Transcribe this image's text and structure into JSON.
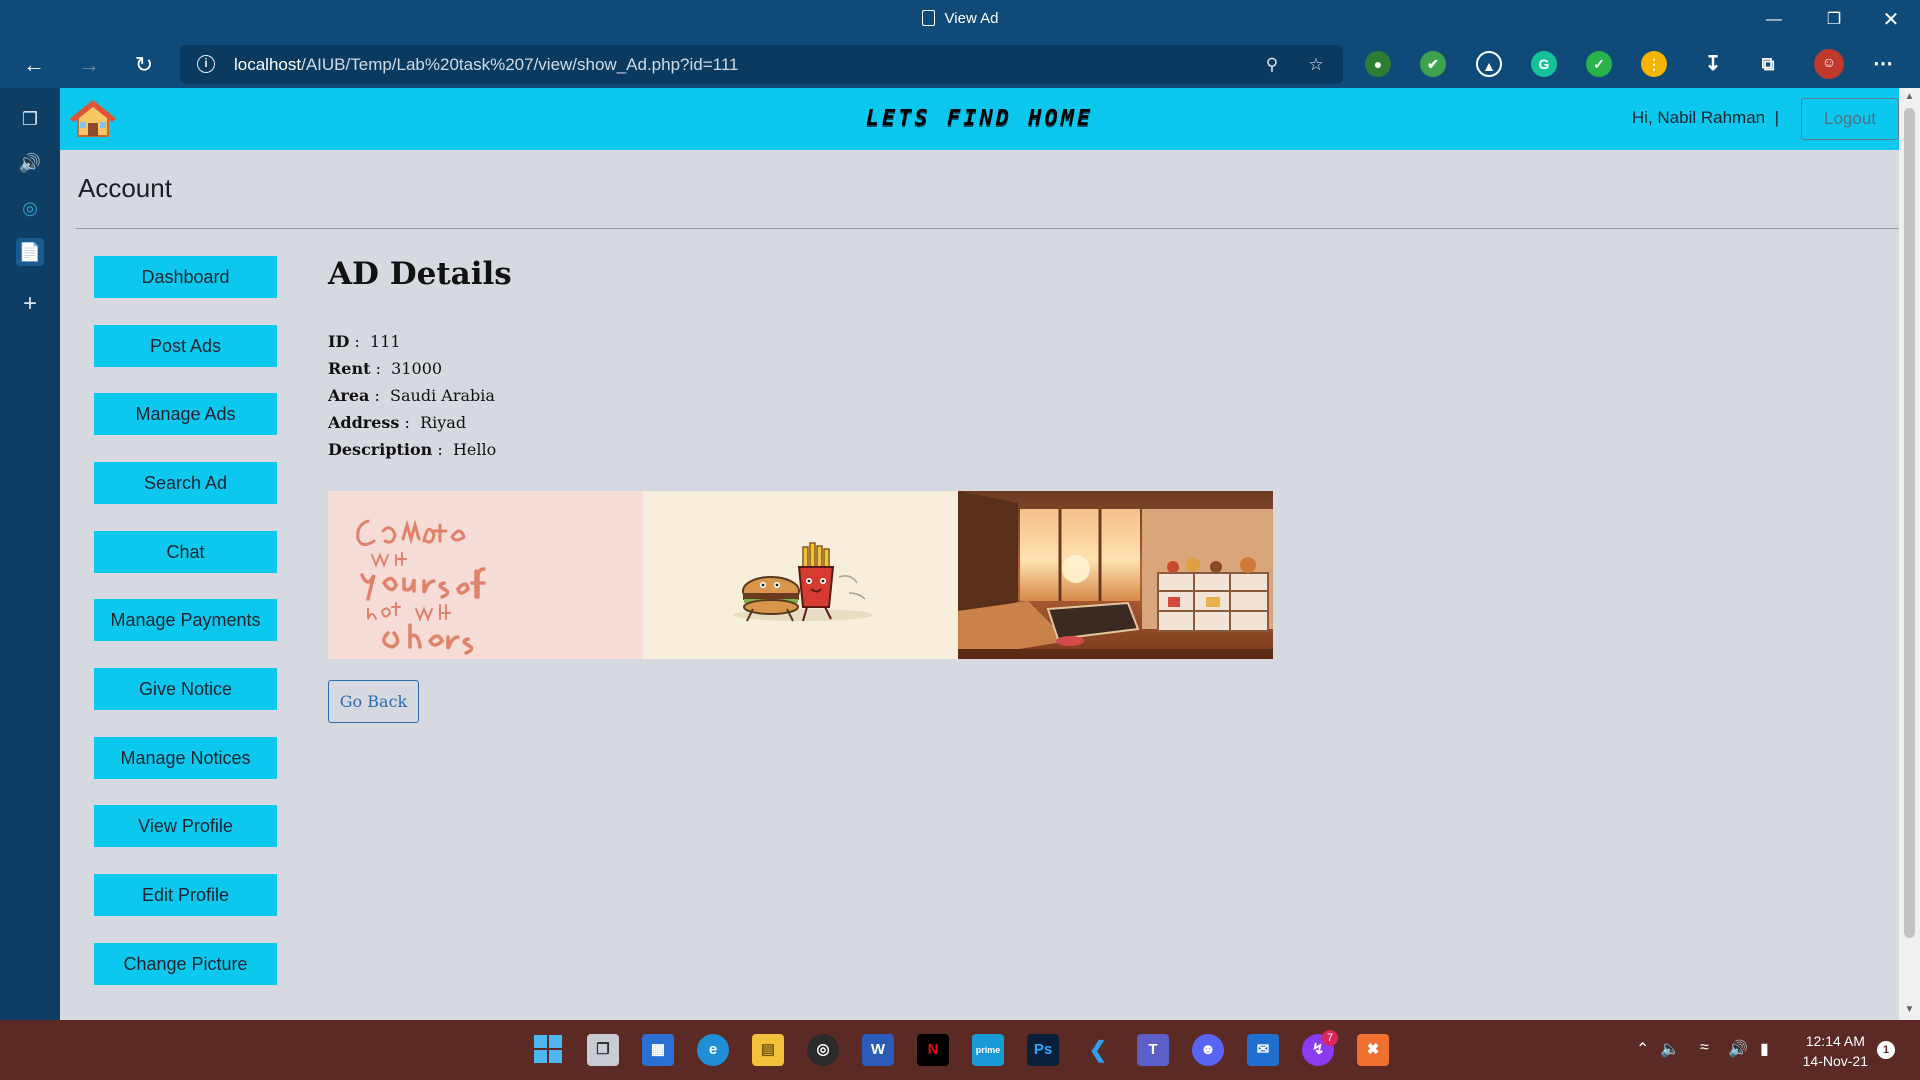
{
  "window": {
    "title": "View Ad"
  },
  "browser": {
    "url_host": "localhost",
    "url_path": "/AIUB/Temp/Lab%20task%207/view/show_Ad.php?id=111"
  },
  "site": {
    "brand": "LETS FIND HOME",
    "greeting": "Hi, Nabil Rahman",
    "greeting_sep": "|",
    "logout_label": "Logout",
    "section_title": "Account"
  },
  "menu": [
    {
      "label": "Dashboard"
    },
    {
      "label": "Post Ads"
    },
    {
      "label": "Manage Ads"
    },
    {
      "label": "Search Ad"
    },
    {
      "label": "Chat"
    },
    {
      "label": "Manage Payments"
    },
    {
      "label": "Give Notice"
    },
    {
      "label": "Manage Notices"
    },
    {
      "label": "View Profile"
    },
    {
      "label": "Edit Profile"
    },
    {
      "label": "Change Picture"
    }
  ],
  "ad": {
    "heading": "AD Details",
    "fields": [
      {
        "label": "ID",
        "value": "111"
      },
      {
        "label": "Rent",
        "value": "31000"
      },
      {
        "label": "Area",
        "value": "Saudi Arabia"
      },
      {
        "label": "Address",
        "value": "Riyad"
      },
      {
        "label": "Description",
        "value": "Hello"
      }
    ],
    "images": [
      {
        "name": "quote-poster",
        "text": "Compete with yourself not with others"
      },
      {
        "name": "burger-fries-cartoon"
      },
      {
        "name": "living-room-sunset"
      }
    ],
    "back_label": "Go Back"
  },
  "taskbar": {
    "time": "12:14 AM",
    "date": "14-Nov-21",
    "messenger_badge": "7",
    "notification_count": "1"
  },
  "colors": {
    "accent": "#0dc8ee",
    "page_bg": "#d6d9df",
    "chrome": "#0f4a78",
    "taskbar": "#5b2a25"
  }
}
